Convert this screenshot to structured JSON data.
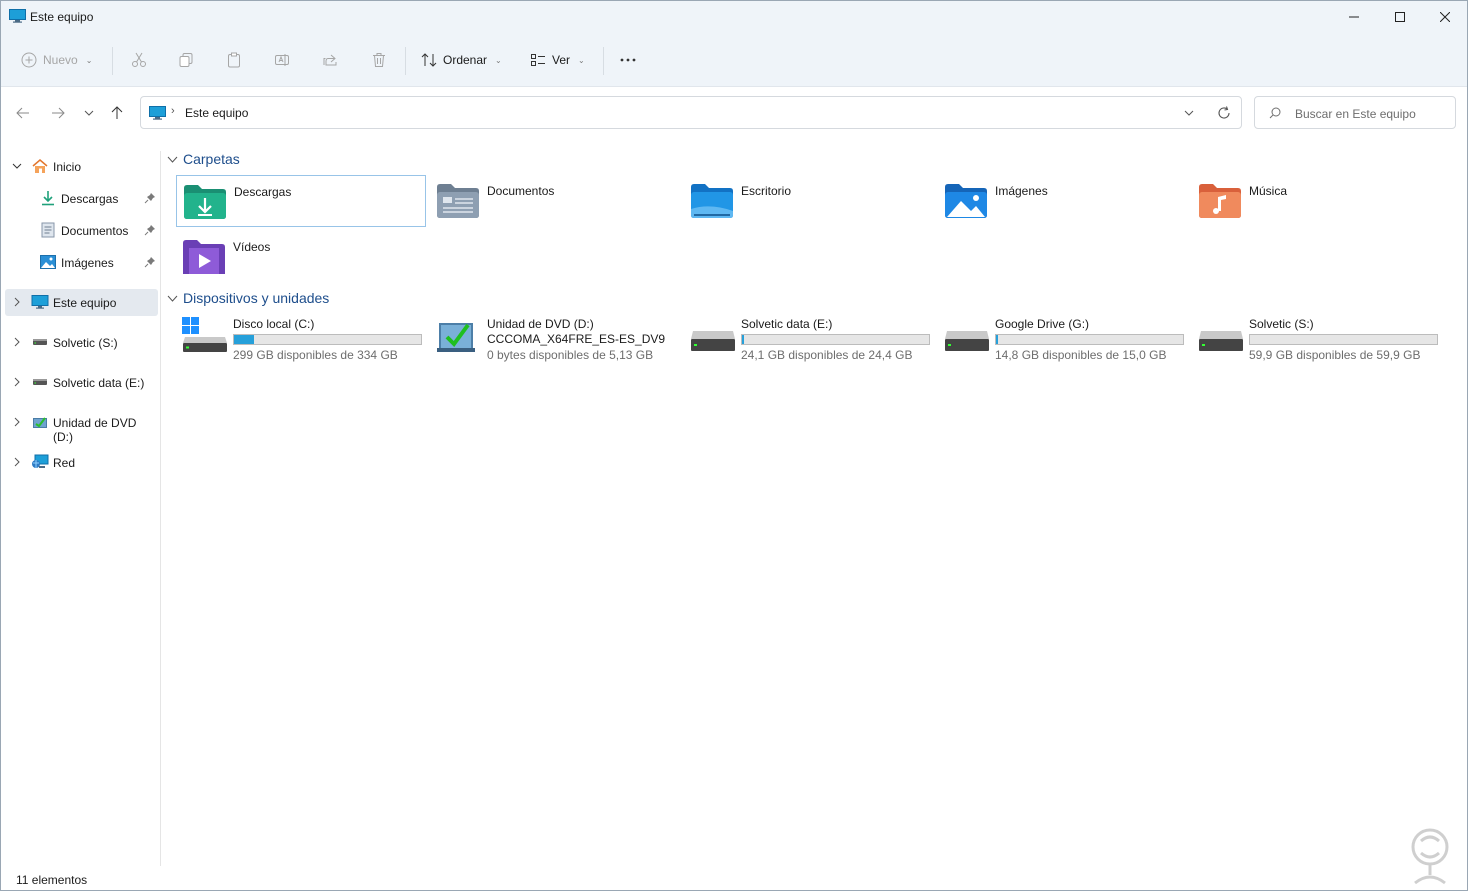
{
  "window": {
    "title": "Este equipo"
  },
  "toolbar": {
    "new_label": "Nuevo",
    "sort_label": "Ordenar",
    "view_label": "Ver",
    "more_label": "···"
  },
  "address": {
    "path": "Este equipo"
  },
  "search": {
    "placeholder": "Buscar en Este equipo"
  },
  "sidebar": {
    "items": [
      {
        "label": "Inicio"
      },
      {
        "label": "Descargas"
      },
      {
        "label": "Documentos"
      },
      {
        "label": "Imágenes"
      },
      {
        "label": "Este equipo"
      },
      {
        "label": "Solvetic (S:)"
      },
      {
        "label": "Solvetic data (E:)"
      },
      {
        "label": "Unidad de DVD (D:)"
      },
      {
        "label": "Red"
      }
    ]
  },
  "sections": {
    "folders": "Carpetas",
    "devices": "Dispositivos y unidades"
  },
  "folders": [
    {
      "label": "Descargas"
    },
    {
      "label": "Documentos"
    },
    {
      "label": "Escritorio"
    },
    {
      "label": "Imágenes"
    },
    {
      "label": "Música"
    },
    {
      "label": "Vídeos"
    }
  ],
  "drives": [
    {
      "name": "Disco local (C:)",
      "free": "299 GB disponibles de 334 GB",
      "used_fraction": 0.105
    },
    {
      "name": "Unidad de DVD (D:)",
      "subname": "CCCOMA_X64FRE_ES-ES_DV9",
      "free": "0 bytes disponibles de 5,13 GB"
    },
    {
      "name": "Solvetic data (E:)",
      "free": "24,1 GB disponibles de 24,4 GB",
      "used_fraction": 0.012
    },
    {
      "name": "Google Drive (G:)",
      "free": "14,8 GB disponibles de 15,0 GB",
      "used_fraction": 0.013
    },
    {
      "name": "Solvetic (S:)",
      "free": "59,9 GB disponibles de 59,9 GB",
      "used_fraction": 0.0
    }
  ],
  "status": {
    "count": "11 elementos"
  },
  "colors": {
    "accent": "#26a0da",
    "section": "#1e4e8c",
    "chrome": "#eff4f9"
  }
}
